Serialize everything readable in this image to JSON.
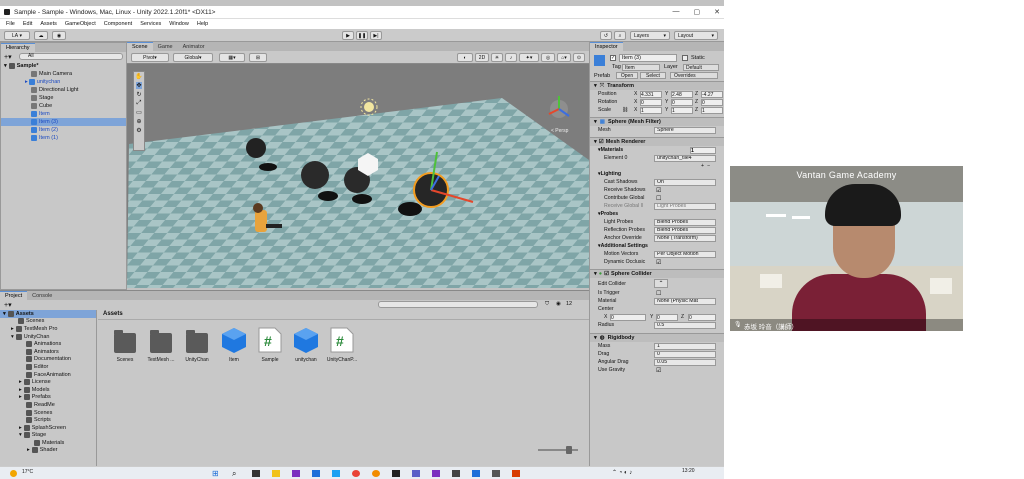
{
  "window": {
    "title": "Sample - Sample - Windows, Mac, Linux - Unity 2022.1.20f1* <DX11>"
  },
  "menu": [
    "File",
    "Edit",
    "Assets",
    "GameObject",
    "Component",
    "Services",
    "Window",
    "Help"
  ],
  "toolbar": {
    "account": "LA",
    "layers": "Layers",
    "layout": "Layout"
  },
  "hierarchy": {
    "tab": "Hierarchy",
    "search": "All",
    "scene": "Sample*",
    "items": [
      {
        "label": "Main Camera"
      },
      {
        "label": "unitychan"
      },
      {
        "label": "Directional Light"
      },
      {
        "label": "Stage"
      },
      {
        "label": "Cube"
      },
      {
        "label": "Item"
      },
      {
        "label": "Item (3)"
      },
      {
        "label": "Item (2)"
      },
      {
        "label": "Item (1)"
      }
    ]
  },
  "scene": {
    "tabs": [
      "Scene",
      "Game",
      "Animator"
    ],
    "pivot": "Pivot",
    "global": "Global",
    "persp": "< Persp",
    "mode2d": "2D"
  },
  "inspector": {
    "tab": "Inspector",
    "name": "Item (3)",
    "static": "Static",
    "tag_label": "Tag",
    "tag": "Item",
    "layer_label": "Layer",
    "layer": "Default",
    "prefab_label": "Prefab",
    "open": "Open",
    "select": "Select",
    "overrides": "Overrides",
    "transform": {
      "title": "Transform",
      "position": "Position",
      "rotation": "Rotation",
      "scale": "Scale",
      "pos": [
        "4.331",
        "2.48",
        "-4.27"
      ],
      "rot": [
        "0",
        "0",
        "0"
      ],
      "scl": [
        "1",
        "1",
        "1"
      ]
    },
    "mesh_filter": {
      "title": "Sphere (Mesh Filter)",
      "mesh_label": "Mesh",
      "mesh": "Sphere"
    },
    "renderer": {
      "title": "Mesh Renderer",
      "materials": "Materials",
      "count": "1",
      "element": "Element 0",
      "material": "unitychan_tile4",
      "lighting": "Lighting",
      "cast_shadows": "Cast Shadows",
      "cast_value": "On",
      "receive": "Receive Shadows",
      "contribute": "Contribute Global",
      "receive_gi": "Receive Global Il",
      "receive_gi_value": "Light Probes",
      "probes": "Probes",
      "light_probes": "Light Probes",
      "light_value": "Blend Probes",
      "reflection": "Reflection Probes",
      "reflection_value": "Blend Probes",
      "anchor": "Anchor Override",
      "anchor_value": "None (Transform)",
      "additional": "Additional Settings",
      "motion": "Motion Vectors",
      "motion_value": "Per Object Motion",
      "dynamic": "Dynamic Occlusic"
    },
    "collider": {
      "title": "Sphere Collider",
      "edit": "Edit Collider",
      "trigger": "Is Trigger",
      "material": "Material",
      "material_value": "None (Physic Mat",
      "center": "Center",
      "cx": "0",
      "cy": "0",
      "cz": "0",
      "radius": "Radius",
      "radius_value": "0.5"
    },
    "rigidbody": {
      "title": "Rigidbody",
      "mass": "Mass",
      "mass_value": "1",
      "drag": "Drag",
      "drag_value": "0",
      "angular": "Angular Drag",
      "angular_value": "0.05",
      "gravity": "Use Gravity"
    }
  },
  "project": {
    "tabs": [
      "Project",
      "Console"
    ],
    "count": "12",
    "path": "Assets",
    "tree": [
      {
        "label": "Assets"
      },
      {
        "label": "Scenes"
      },
      {
        "label": "TextMesh Pro"
      },
      {
        "label": "UnityChan"
      },
      {
        "label": "Animations"
      },
      {
        "label": "Animators"
      },
      {
        "label": "Documentation"
      },
      {
        "label": "Editor"
      },
      {
        "label": "FaceAnimation"
      },
      {
        "label": "License"
      },
      {
        "label": "Models"
      },
      {
        "label": "Prefabs"
      },
      {
        "label": "ReadMe"
      },
      {
        "label": "Scenes"
      },
      {
        "label": "Scripts"
      },
      {
        "label": "SplashScreen"
      },
      {
        "label": "Stage"
      },
      {
        "label": "Materials"
      },
      {
        "label": "Shader"
      }
    ],
    "assets": [
      {
        "label": "Scenes"
      },
      {
        "label": "TextMesh ..."
      },
      {
        "label": "UnityChan"
      },
      {
        "label": "Item"
      },
      {
        "label": "Sample"
      },
      {
        "label": "unitychan"
      },
      {
        "label": "UnityChanP..."
      }
    ]
  },
  "webcam": {
    "sign": "Vantan Game Academy",
    "caption": "赤坂 玲音（講師）"
  },
  "taskbar": {
    "weather": "17°C",
    "time": "13:20"
  }
}
